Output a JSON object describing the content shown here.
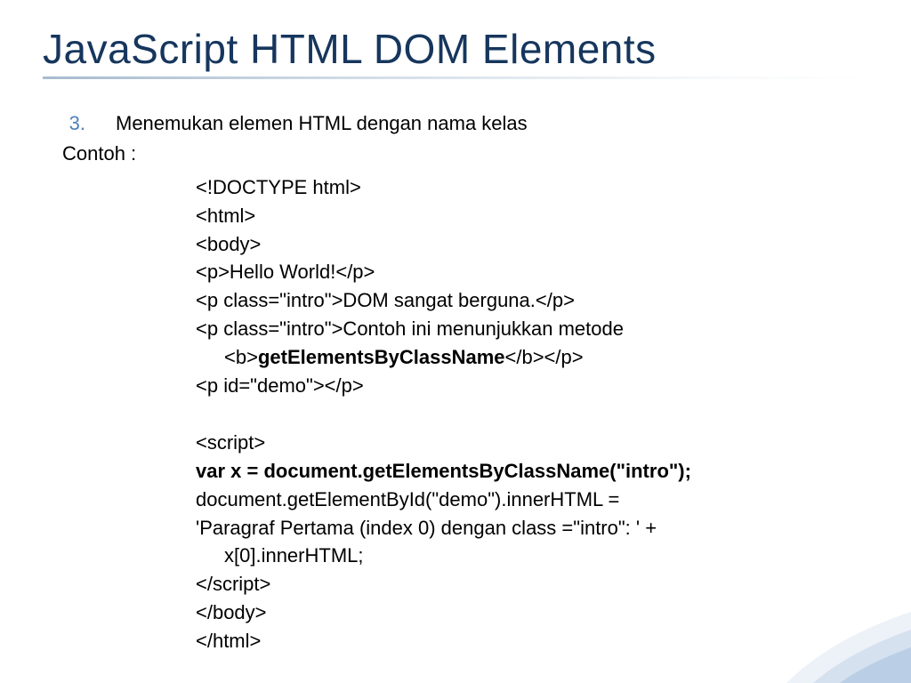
{
  "title": "JavaScript HTML DOM Elements",
  "list_number": "3.",
  "list_text": "Menemukan elemen HTML dengan nama kelas",
  "contoh": "Contoh :",
  "code": {
    "l1": "<!DOCTYPE html>",
    "l2": "<html>",
    "l3": "<body>",
    "l4": "<p>Hello World!</p>",
    "l5": "<p class=\"intro\">DOM sangat berguna.</p>",
    "l6a": "<p class=\"intro\">Contoh ini menunjukkan metode ",
    "l6b_pre": "<b>",
    "l6b_bold": "getElementsByClassName",
    "l6b_post": "</b></p>",
    "l7": "<p id=\"demo\"></p>",
    "l8": "<script>",
    "l9": "var x = document.getElementsByClassName(\"intro\");",
    "l10": "document.getElementById(\"demo\").innerHTML = ",
    "l11a": "'Paragraf Pertama (index 0) dengan class =\"intro\": ' + ",
    "l11b": "x[0].innerHTML;",
    "l12": "</script>",
    "l13": "</body>",
    "l14": "</html>"
  }
}
